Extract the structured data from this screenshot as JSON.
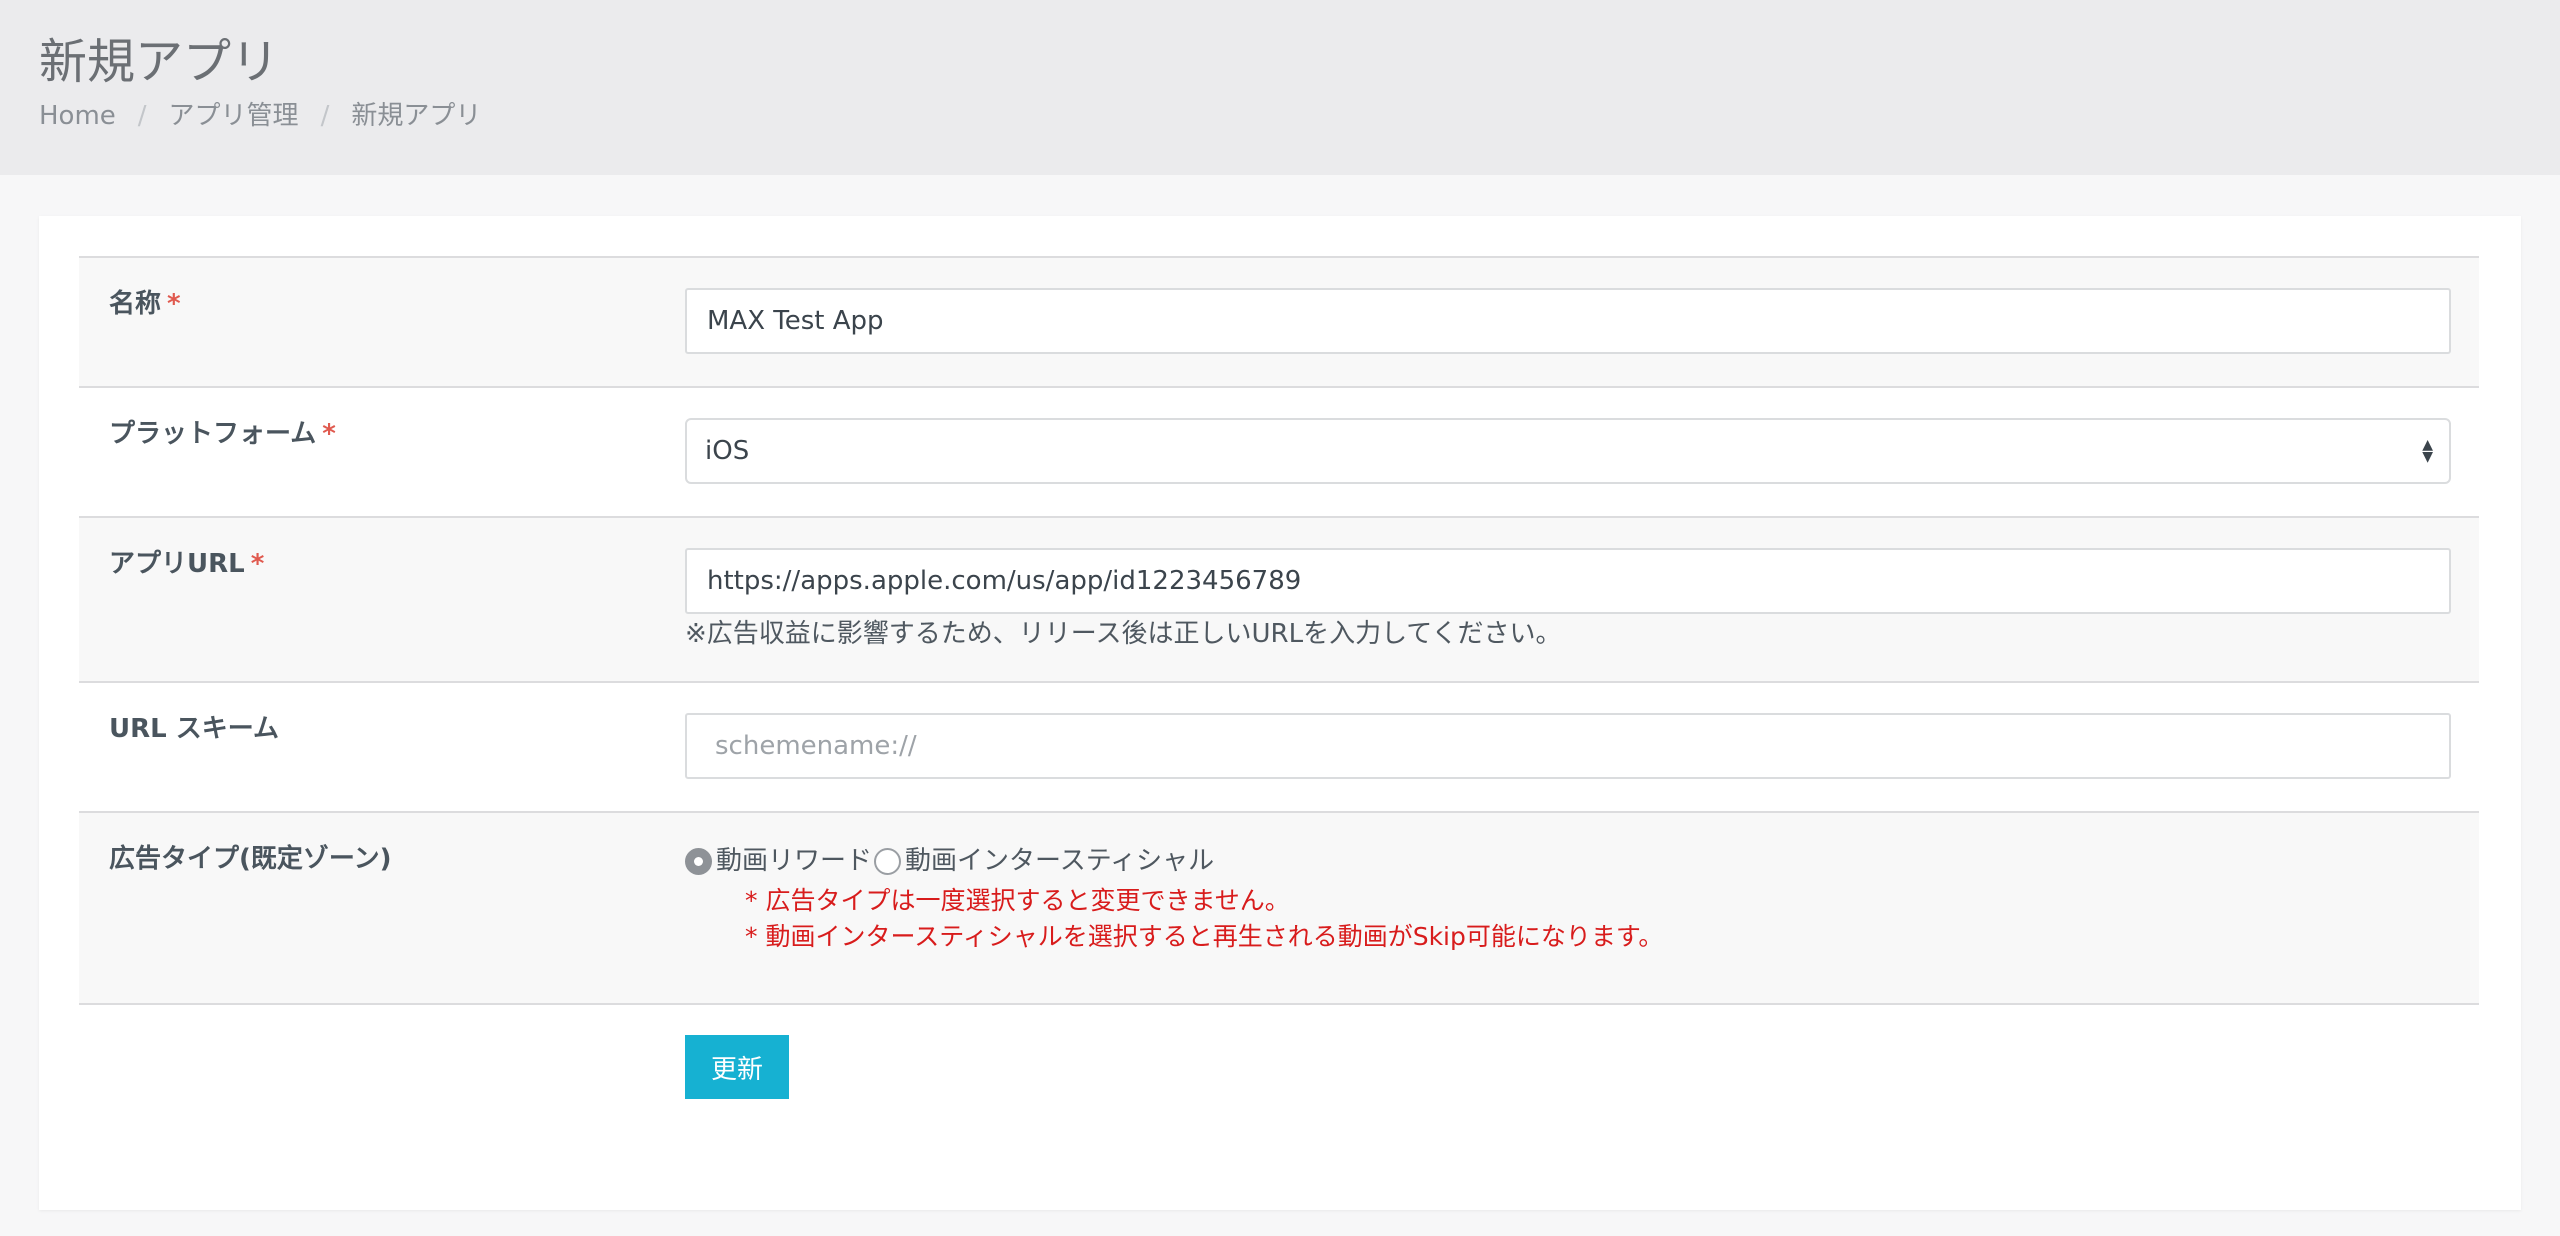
{
  "header": {
    "title": "新規アプリ",
    "breadcrumb": [
      "Home",
      "アプリ管理",
      "新規アプリ"
    ],
    "separator": "/"
  },
  "form": {
    "name": {
      "label": "名称",
      "required_mark": "*",
      "value": "MAX Test App"
    },
    "platform": {
      "label": "プラットフォーム",
      "required_mark": "*",
      "selected": "iOS",
      "arrow_up": "▲",
      "arrow_down": "▼"
    },
    "app_url": {
      "label": "アプリURL",
      "required_mark": "*",
      "value": "https://apps.apple.com/us/app/id1223456789",
      "hint": "※広告収益に影響するため、リリース後は正しいURLを入力してください。"
    },
    "url_scheme": {
      "label": "URL スキーム",
      "placeholder": "schemename://",
      "value": ""
    },
    "ad_type": {
      "label": "広告タイプ(既定ゾーン)",
      "options": [
        {
          "label": "動画リワード",
          "checked": true
        },
        {
          "label": "動画インタースティシャル",
          "checked": false
        }
      ],
      "notes": [
        "* 広告タイプは一度選択すると変更できません。",
        "* 動画インタースティシャルを選択すると再生される動画がSkip可能になります。"
      ]
    },
    "submit_label": "更新"
  },
  "colors": {
    "header_bg": "#ebebed",
    "accent_button": "#16b1d2",
    "required": "#e05a4f",
    "warning_text": "#d81c1c"
  }
}
